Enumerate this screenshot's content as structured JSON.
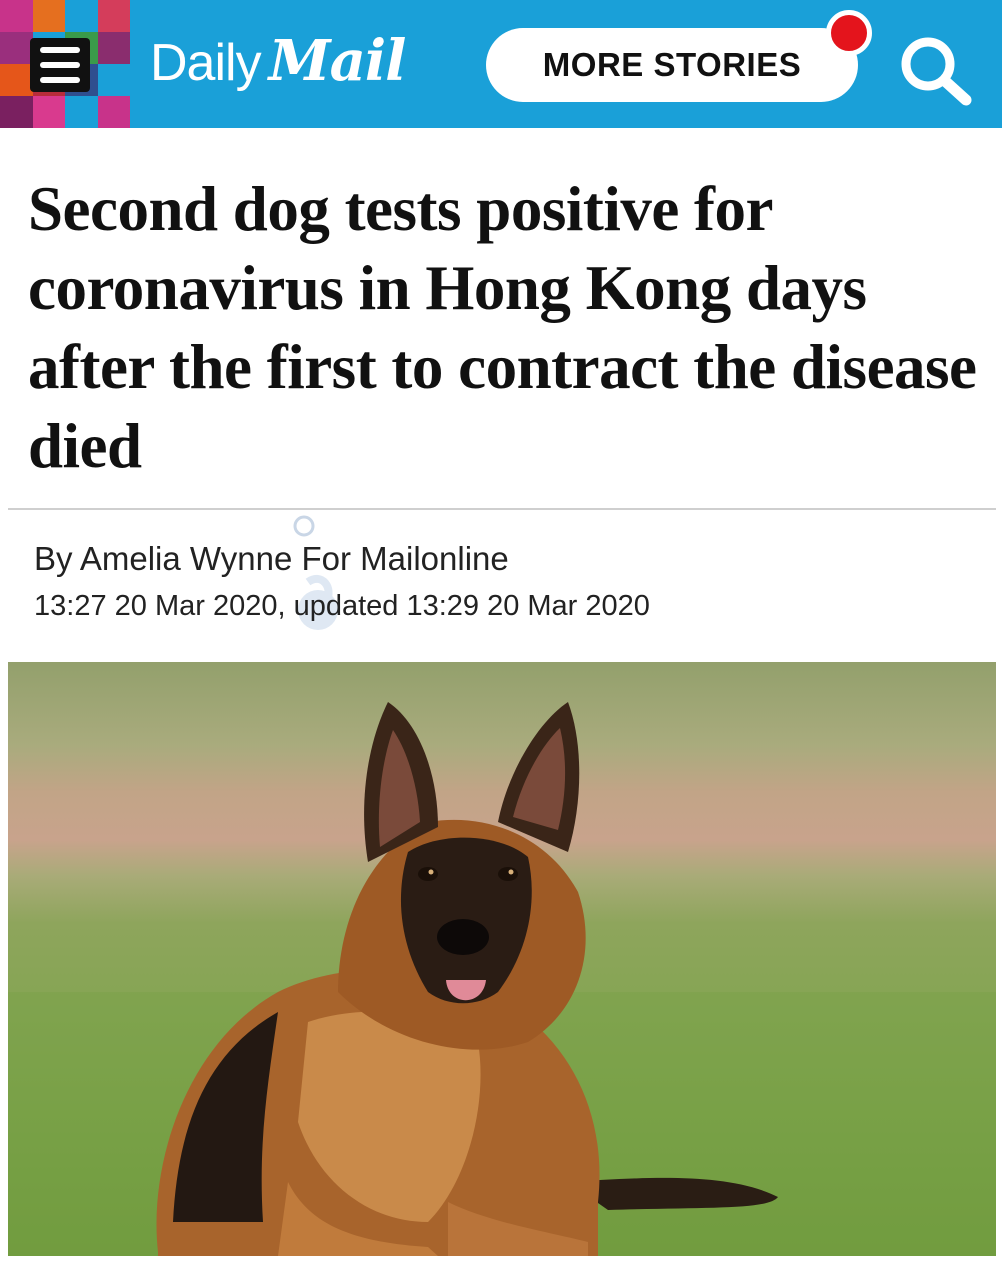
{
  "header": {
    "logo_daily": "Daily",
    "logo_mail": "Mail",
    "more_stories_label": "MORE STORIES",
    "brand_color": "#1aa0d8",
    "notification_color": "#e4141c",
    "menu_icon": "hamburger-menu-icon",
    "search_icon": "search-icon"
  },
  "article": {
    "headline": "Second dog tests positive for coronavirus in Hong Kong days after the first to contract the disease died",
    "byline": "By Amelia Wynne For Mailonline",
    "dateline": "13:27 20 Mar 2020, updated 13:29 20 Mar 2020"
  },
  "photo": {
    "subject": "dog-photo"
  }
}
